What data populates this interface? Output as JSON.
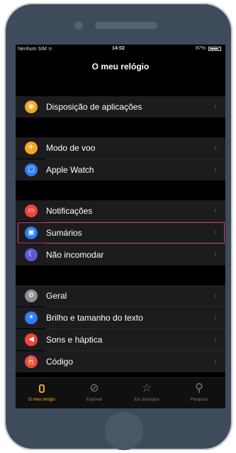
{
  "status_bar": {
    "carrier": "Nenhum SIM ᯤ",
    "time": "14:02",
    "battery": "87%"
  },
  "nav": {
    "title": "O meu relógio"
  },
  "items": [
    {
      "label": "Disposição de aplicações",
      "icon": "app-layout-icon",
      "color": "#f5a623",
      "glyph": "◉"
    },
    {
      "label": "Modo de voo",
      "icon": "airplane-icon",
      "color": "#f5a623",
      "glyph": "✈"
    },
    {
      "label": "Apple Watch",
      "icon": "watch-icon",
      "color": "#2f7cf6",
      "glyph": "▢"
    },
    {
      "label": "Notificações",
      "icon": "notifications-icon",
      "color": "#f0443a",
      "glyph": "▭"
    },
    {
      "label": "Sumários",
      "icon": "glances-icon",
      "color": "#2f7cf6",
      "glyph": "▣"
    },
    {
      "label": "Não incomodar",
      "icon": "moon-icon",
      "color": "#5b5bd6",
      "glyph": "☾"
    },
    {
      "label": "Geral",
      "icon": "gear-icon",
      "color": "#8e8e93",
      "glyph": "⚙"
    },
    {
      "label": "Brilho e tamanho do texto",
      "icon": "brightness-icon",
      "color": "#2f7cf6",
      "glyph": "☀"
    },
    {
      "label": "Sons e háptica",
      "icon": "sound-icon",
      "color": "#f0443a",
      "glyph": "◀"
    },
    {
      "label": "Código",
      "icon": "lock-icon",
      "color": "#f0445a",
      "glyph": "🔒"
    }
  ],
  "highlighted_item": "Sumários",
  "highlight_color": "#d63a74",
  "tabs": [
    {
      "label": "O meu relógio",
      "icon": "watch-tab-icon",
      "active": true
    },
    {
      "label": "Explorar",
      "icon": "compass-icon",
      "active": false,
      "glyph": "⊘"
    },
    {
      "label": "Em destaque",
      "icon": "star-icon",
      "active": false,
      "glyph": "☆"
    },
    {
      "label": "Pesquisa",
      "icon": "search-icon",
      "active": false,
      "glyph": "⚲"
    }
  ],
  "accent_color": "#f5a623"
}
